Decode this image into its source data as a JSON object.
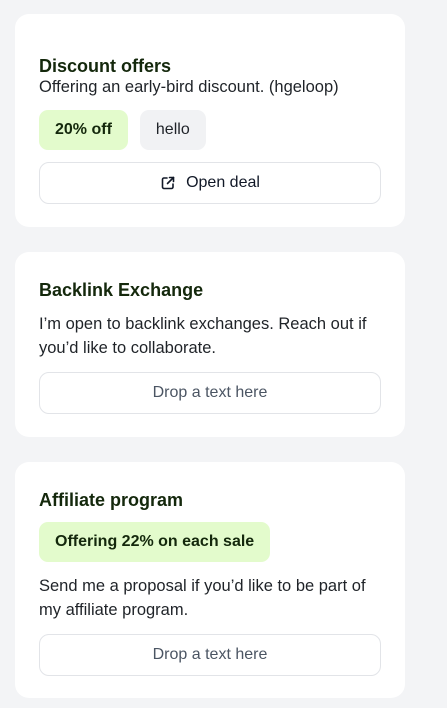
{
  "discount": {
    "title": "Discount offers",
    "description": "Offering an early-bird discount. (hgeloop)",
    "tags": [
      "20% off",
      "hello"
    ],
    "button_label": "Open deal",
    "button_icon": "external-link-icon"
  },
  "backlink": {
    "title": "Backlink Exchange",
    "description_line1": "I’m open to backlink exchanges. Reach out if",
    "description_line2": "you’d like to collaborate.",
    "button_label": "Drop a text here"
  },
  "affiliate": {
    "title": "Affiliate program",
    "tag": "Offering 22% on each sale",
    "description_line1": "Send me a proposal if you’d like to be part of",
    "description_line2": "my affiliate program.",
    "button_label": "Drop a text here"
  },
  "colors": {
    "page_background": "#f3f4f6",
    "card_background": "#ffffff",
    "title": "#14280c",
    "tag_green": "#e3fbcc",
    "tag_gray": "#f1f2f4",
    "button_border": "#e2e4e8"
  }
}
